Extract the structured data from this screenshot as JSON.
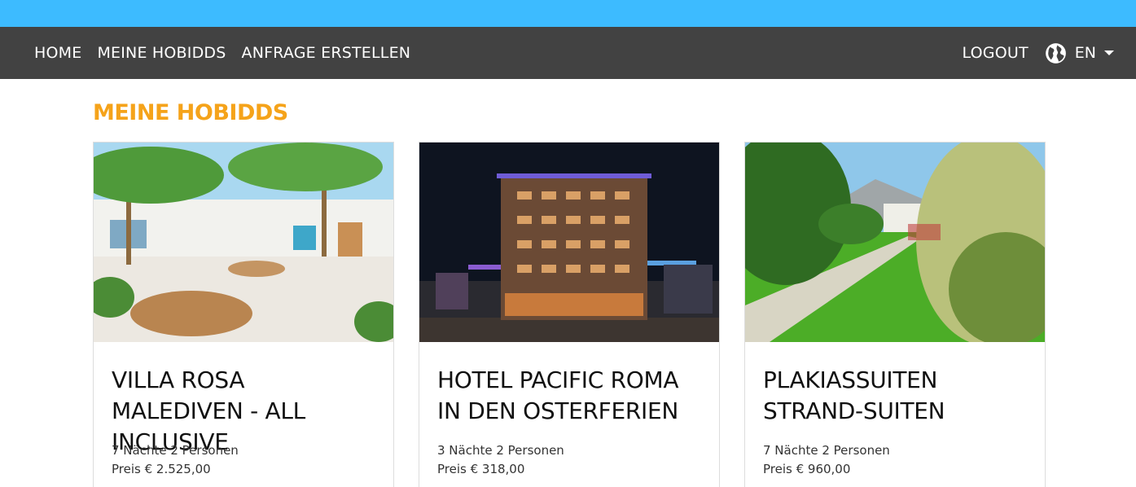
{
  "nav": {
    "left": [
      "HOME",
      "MEINE HOBIDDS",
      "ANFRAGE ERSTELLEN"
    ],
    "logout": "LOGOUT",
    "lang": "EN"
  },
  "page": {
    "title": "MEINE HOBIDDS"
  },
  "cards": [
    {
      "title": "VILLA ROSA MALEDIVEN - ALL INCLUSIVE",
      "meta": "7 Nächte 2 Personen",
      "price": "Preis € 2.525,00"
    },
    {
      "title": "HOTEL PACIFIC ROMA IN DEN OSTERFERIEN",
      "meta": "3 Nächte 2 Personen",
      "price": "Preis € 318,00"
    },
    {
      "title": "PLAKIASSUITEN STRAND-SUITEN",
      "meta": "7 Nächte 2 Personen",
      "price": "Preis € 960,00"
    }
  ],
  "colors": {
    "topbar": "#3dbbff",
    "navbar": "#424242",
    "accent": "#f5a31a"
  },
  "icons": {
    "globe": "globe-icon",
    "caret": "caret-down-icon"
  }
}
